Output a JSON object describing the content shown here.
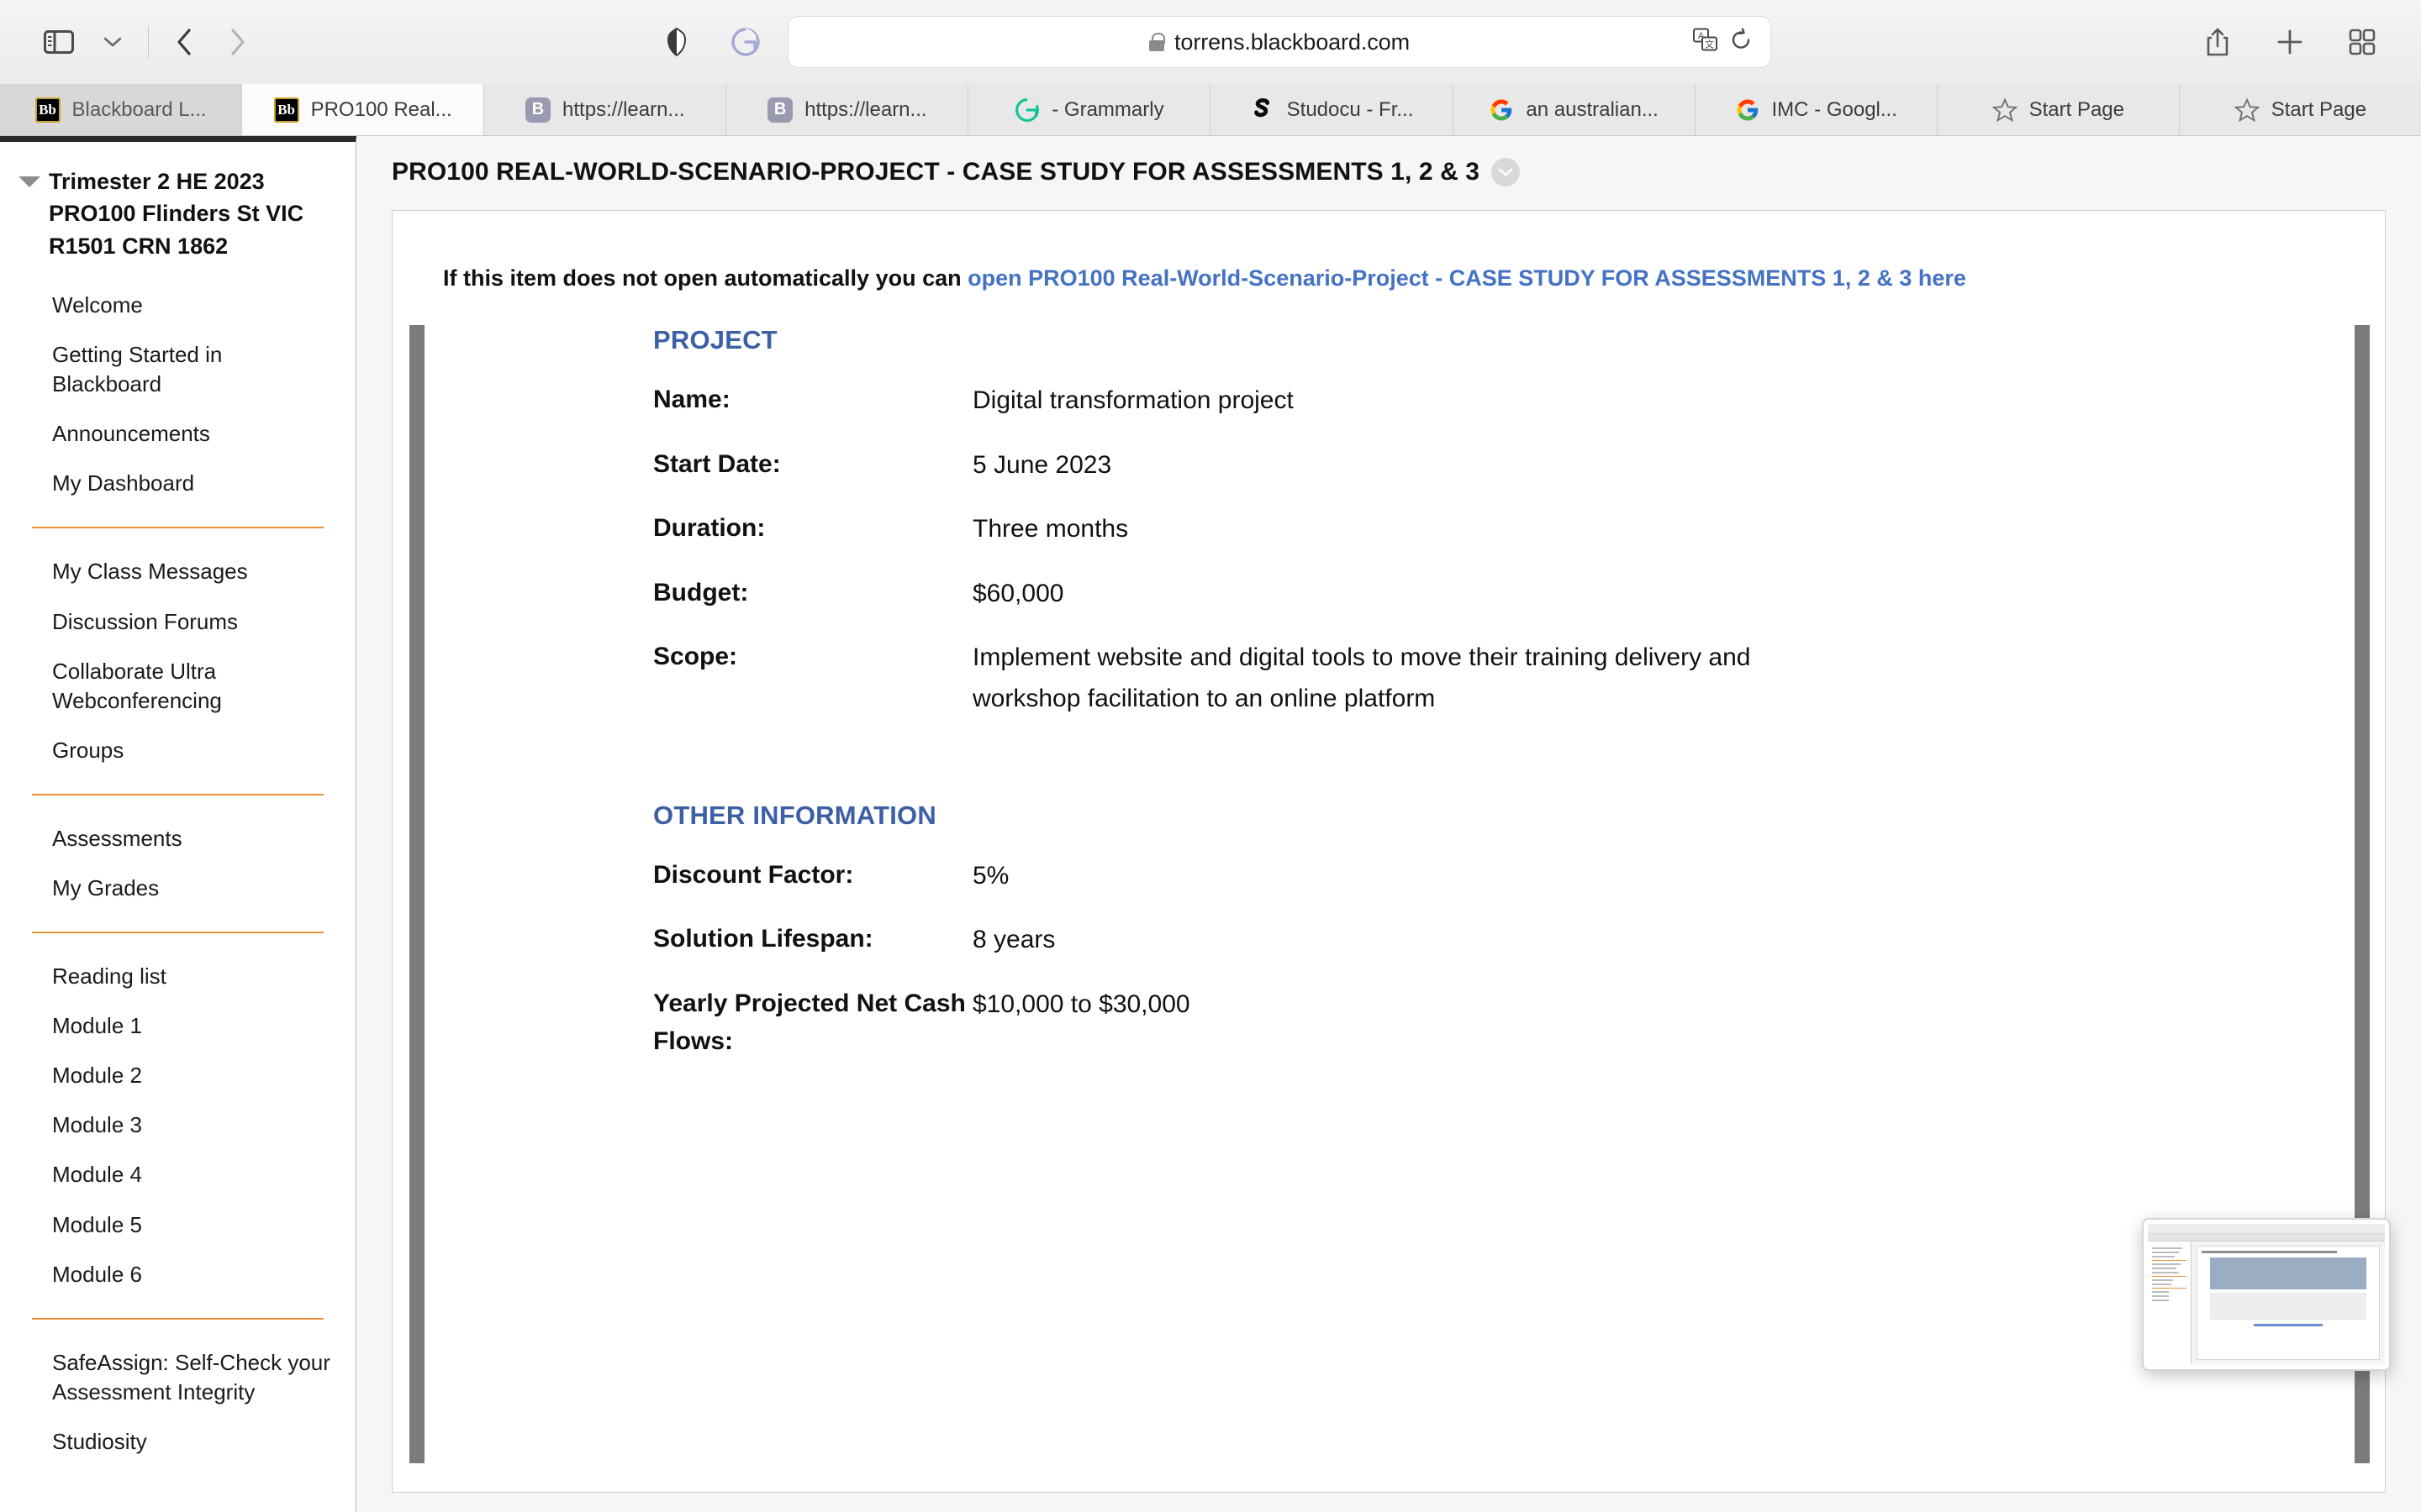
{
  "browser": {
    "toolbar": {
      "sidebar_toggle_icon": "sidebar-toggle-icon",
      "sidebar_dropdown_icon": "chevron-down-icon",
      "back_icon": "back-arrow-icon",
      "forward_icon": "forward-arrow-icon",
      "shield_icon": "privacy-shield-icon",
      "grammarly_icon": "grammarly-extension-icon",
      "translate_icon": "translate-icon",
      "reload_icon": "reload-icon",
      "share_icon": "share-icon",
      "new_tab_icon": "plus-icon",
      "tab_overview_icon": "tab-overview-icon"
    },
    "url": {
      "lock_icon": "lock-icon",
      "text": "torrens.blackboard.com"
    },
    "tabs": [
      {
        "label": "Blackboard L...",
        "favicon": "blackboard-bb-icon",
        "active": false,
        "first": true
      },
      {
        "label": "PRO100 Real...",
        "favicon": "blackboard-bb-icon",
        "active": true,
        "first": false
      },
      {
        "label": "https://learn...",
        "favicon": "generic-b-icon",
        "active": false,
        "first": false
      },
      {
        "label": "https://learn...",
        "favicon": "generic-b-icon",
        "active": false,
        "first": false
      },
      {
        "label": "- Grammarly",
        "favicon": "grammarly-icon",
        "active": false,
        "first": false
      },
      {
        "label": "Studocu - Fr...",
        "favicon": "studocu-icon",
        "active": false,
        "first": false
      },
      {
        "label": "an australian...",
        "favicon": "google-icon",
        "active": false,
        "first": false
      },
      {
        "label": "IMC - Googl...",
        "favicon": "google-icon",
        "active": false,
        "first": false
      },
      {
        "label": "Start Page",
        "favicon": "star-icon",
        "active": false,
        "first": false
      },
      {
        "label": "Start Page",
        "favicon": "star-icon",
        "active": false,
        "first": false
      }
    ]
  },
  "sidebar": {
    "collapse_icon": "caret-down-icon",
    "course_title": "Trimester 2 HE 2023 PRO100 Flinders St VIC R1501 CRN 1862",
    "groups": [
      {
        "items": [
          "Welcome",
          "Getting Started in Blackboard",
          "Announcements",
          "My Dashboard"
        ]
      },
      {
        "items": [
          "My Class Messages",
          "Discussion Forums",
          "Collaborate Ultra Webconferencing",
          "Groups"
        ]
      },
      {
        "items": [
          "Assessments",
          "My Grades"
        ]
      },
      {
        "items": [
          "Reading list",
          "Module 1",
          "Module 2",
          "Module 3",
          "Module 4",
          "Module 5",
          "Module 6"
        ]
      },
      {
        "items": [
          "SafeAssign: Self-Check your Assessment Integrity",
          "Studiosity"
        ]
      }
    ]
  },
  "content": {
    "title": "PRO100 REAL-WORLD-SCENARIO-PROJECT - CASE STUDY FOR ASSESSMENTS 1, 2 & 3",
    "title_menu_icon": "chevron-down-circle-icon",
    "notice_prefix": "If this item does not open automatically you can ",
    "notice_link": "open PRO100 Real-World-Scenario-Project - CASE STUDY FOR ASSESSMENTS 1, 2 & 3 here",
    "link_color": "#4472c4",
    "heading_color": "#3c5fa5",
    "document": {
      "sections": [
        {
          "title": "PROJECT",
          "rows": [
            {
              "label": "Name:",
              "value": "Digital transformation project"
            },
            {
              "label": "Start Date:",
              "value": "5 June 2023"
            },
            {
              "label": "Duration:",
              "value": "Three months"
            },
            {
              "label": "Budget:",
              "value": "$60,000"
            },
            {
              "label": "Scope:",
              "value": "Implement website and digital tools to move their training delivery and workshop facilitation to an online platform"
            }
          ]
        },
        {
          "title": "OTHER INFORMATION",
          "rows": [
            {
              "label": "Discount Factor:",
              "value": "5%"
            },
            {
              "label": "Solution Lifespan:",
              "value": "8 years"
            },
            {
              "label": "Yearly Projected Net Cash Flows:",
              "value": "$10,000 to $30,000"
            }
          ]
        }
      ]
    }
  },
  "screenshot_preview": {
    "name": "screenshot-thumbnail"
  }
}
